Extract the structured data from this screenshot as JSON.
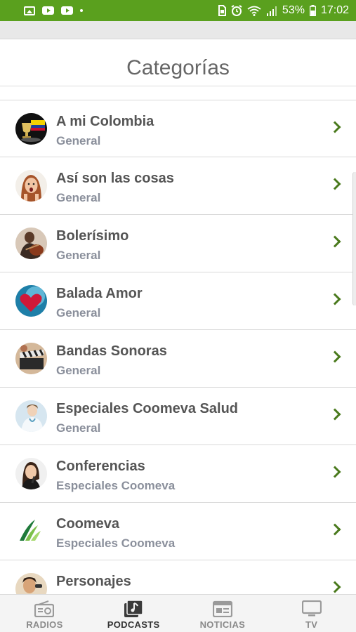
{
  "status_bar": {
    "battery": "53%",
    "time": "17:02",
    "icons": [
      "image-icon",
      "youtube-icon",
      "youtube-icon",
      "dot-icon",
      "sim-icon",
      "alarm-icon",
      "wifi-icon",
      "signal-icon",
      "battery-icon"
    ]
  },
  "header": {
    "title": "Categorías"
  },
  "categories": [
    {
      "title": "A mi Colombia",
      "subtitle": "General",
      "icon": "colombia-cup-avatar"
    },
    {
      "title": "Así son las cosas",
      "subtitle": "General",
      "icon": "surprised-woman-avatar"
    },
    {
      "title": "Bolerísimo",
      "subtitle": "General",
      "icon": "guitarist-avatar"
    },
    {
      "title": "Balada Amor",
      "subtitle": "General",
      "icon": "heart-avatar"
    },
    {
      "title": "Bandas Sonoras",
      "subtitle": "General",
      "icon": "clapperboard-avatar"
    },
    {
      "title": "Especiales Coomeva Salud",
      "subtitle": "General",
      "icon": "doctor-avatar"
    },
    {
      "title": "Conferencias",
      "subtitle": "Especiales Coomeva",
      "icon": "speaker-woman-avatar"
    },
    {
      "title": "Coomeva",
      "subtitle": "Especiales Coomeva",
      "icon": "coomeva-logo-avatar"
    },
    {
      "title": "Personajes",
      "subtitle": "",
      "icon": "singer-avatar"
    }
  ],
  "tabs": [
    {
      "label": "RADIOS",
      "icon": "radio-icon",
      "active": false
    },
    {
      "label": "PODCASTS",
      "icon": "podcast-icon",
      "active": true
    },
    {
      "label": "NOTICIAS",
      "icon": "news-icon",
      "active": false
    },
    {
      "label": "TV",
      "icon": "tv-icon",
      "active": false
    }
  ],
  "colors": {
    "status_bar": "#5aa01e",
    "accent": "#4a7a1d",
    "title_text": "#555555",
    "subtitle_text": "#8a8f9b"
  }
}
